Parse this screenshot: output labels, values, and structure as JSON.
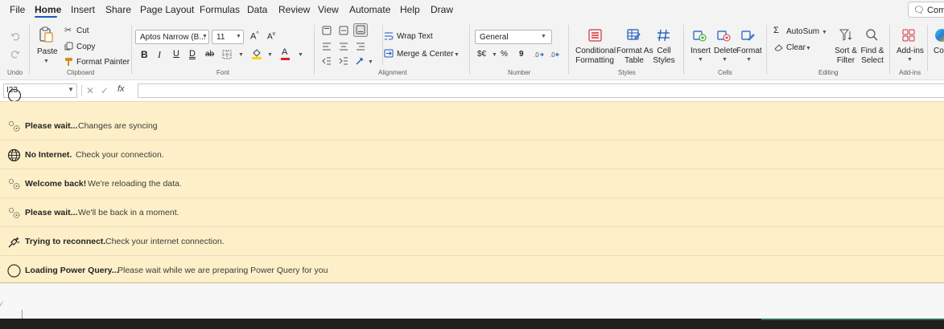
{
  "menu": {
    "tabs": [
      "File",
      "Home",
      "Insert",
      "Share",
      "Page Layout",
      "Formulas",
      "Data",
      "Review",
      "View",
      "Automate",
      "Help",
      "Draw"
    ],
    "active_tab": "Home",
    "comments_label": "Comments"
  },
  "ribbon": {
    "undo": {
      "group_label": "Undo"
    },
    "clipboard": {
      "paste_label": "Paste",
      "cut_label": "Cut",
      "copy_label": "Copy",
      "format_painter_label": "Format Painter",
      "group_label": "Clipboard"
    },
    "font": {
      "font_name": "Aptos Narrow (B...",
      "font_size": "11",
      "bold": "B",
      "italic": "I",
      "underline": "U",
      "double_underline": "D",
      "strikethrough": "ab",
      "group_label": "Font"
    },
    "alignment": {
      "wrap_text_label": "Wrap Text",
      "merge_center_label": "Merge & Center",
      "group_label": "Alignment"
    },
    "number": {
      "format_value": "General",
      "currency_label": "$€",
      "percent_label": "%",
      "comma_label": "9",
      "group_label": "Number"
    },
    "styles": {
      "conditional_line1": "Conditional",
      "conditional_line2": "Formatting",
      "format_table_line1": "Format As",
      "format_table_line2": "Table",
      "cell_styles_line1": "Cell",
      "cell_styles_line2": "Styles",
      "group_label": "Styles"
    },
    "cells": {
      "insert_label": "Insert",
      "delete_label": "Delete",
      "format_label": "Format",
      "group_label": "Cells"
    },
    "editing": {
      "autosum_label": "AutoSum",
      "clear_label": "Clear",
      "sort_line1": "Sort &",
      "sort_line2": "Filter",
      "find_line1": "Find &",
      "find_line2": "Select",
      "group_label": "Editing"
    },
    "addins": {
      "addins_label": "Add-ins",
      "group_label": "Add-ins",
      "copilot_label": "Co"
    }
  },
  "formula_bar": {
    "name_box_value": "I23",
    "formula_value": ""
  },
  "notifications": [
    {
      "icon": "gears-icon",
      "title": "Please wait...",
      "message": "Changes are syncing"
    },
    {
      "icon": "globe-icon",
      "title": "No Internet.",
      "message": "Check your connection."
    },
    {
      "icon": "gears-icon",
      "title": "Welcome back!",
      "message": "We're reloading the data."
    },
    {
      "icon": "gears-icon",
      "title": "Please wait...",
      "message": "We'll be back in a moment."
    },
    {
      "icon": "plug-icon",
      "title": "Trying to reconnect.",
      "message": "Check your internet connection."
    },
    {
      "icon": "spinner-icon",
      "title": "Loading Power Query...",
      "message": "Please wait while we are preparing Power Query for you"
    }
  ],
  "colors": {
    "accent": "#185abd",
    "panel_bg": "#fdf0c8",
    "ribbon_bg": "#f3f3f3",
    "taskbar": "#201f1e"
  }
}
